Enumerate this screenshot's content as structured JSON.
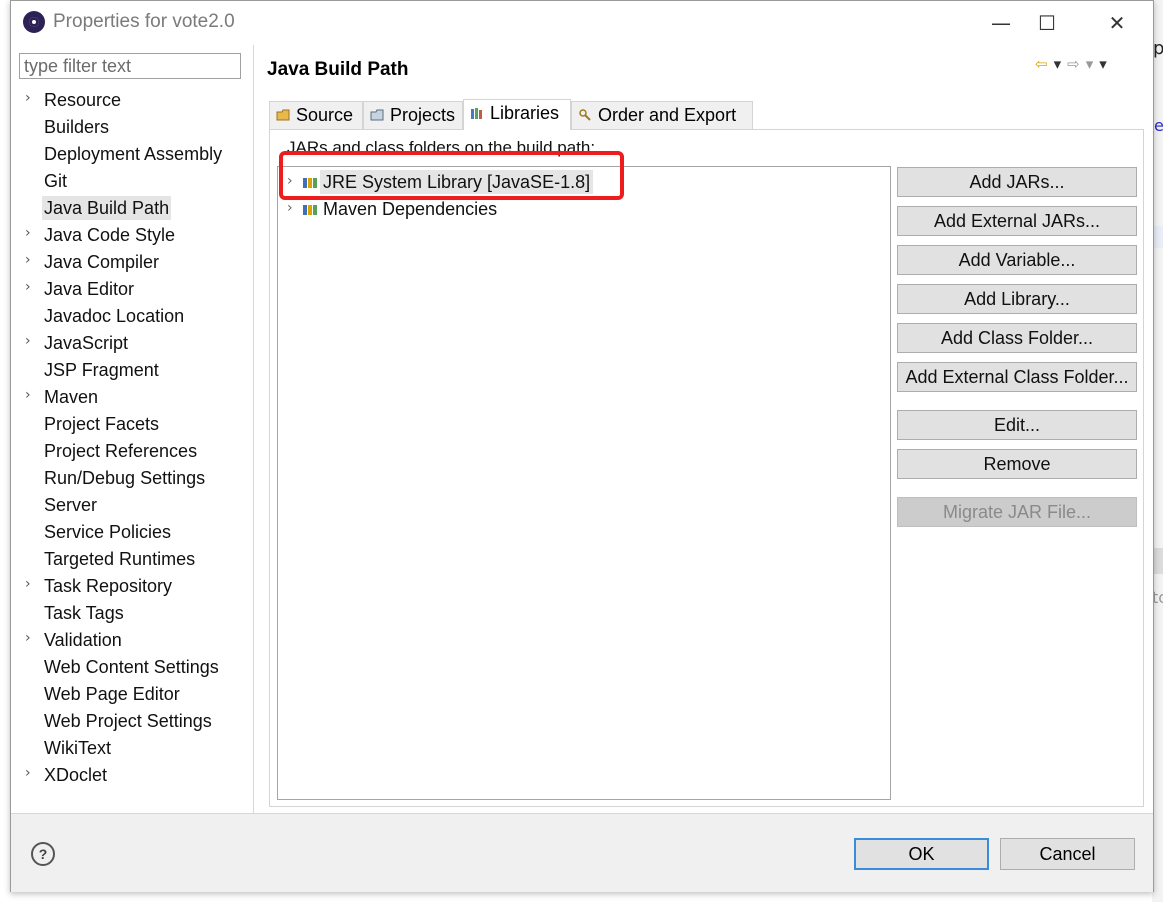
{
  "window": {
    "title": "Properties for vote2.0",
    "minimize": "—",
    "maximize": "☐",
    "close": "✕"
  },
  "filter": {
    "placeholder": "type filter text",
    "value": ""
  },
  "tree": {
    "items": [
      {
        "label": "Resource",
        "expandable": true
      },
      {
        "label": "Builders",
        "expandable": false
      },
      {
        "label": "Deployment Assembly",
        "expandable": false
      },
      {
        "label": "Git",
        "expandable": false
      },
      {
        "label": "Java Build Path",
        "expandable": false,
        "selected": true
      },
      {
        "label": "Java Code Style",
        "expandable": true
      },
      {
        "label": "Java Compiler",
        "expandable": true
      },
      {
        "label": "Java Editor",
        "expandable": true
      },
      {
        "label": "Javadoc Location",
        "expandable": false
      },
      {
        "label": "JavaScript",
        "expandable": true
      },
      {
        "label": "JSP Fragment",
        "expandable": false
      },
      {
        "label": "Maven",
        "expandable": true
      },
      {
        "label": "Project Facets",
        "expandable": false
      },
      {
        "label": "Project References",
        "expandable": false
      },
      {
        "label": "Run/Debug Settings",
        "expandable": false
      },
      {
        "label": "Server",
        "expandable": false
      },
      {
        "label": "Service Policies",
        "expandable": false
      },
      {
        "label": "Targeted Runtimes",
        "expandable": false
      },
      {
        "label": "Task Repository",
        "expandable": true
      },
      {
        "label": "Task Tags",
        "expandable": false
      },
      {
        "label": "Validation",
        "expandable": true
      },
      {
        "label": "Web Content Settings",
        "expandable": false
      },
      {
        "label": "Web Page Editor",
        "expandable": false
      },
      {
        "label": "Web Project Settings",
        "expandable": false
      },
      {
        "label": "WikiText",
        "expandable": false
      },
      {
        "label": "XDoclet",
        "expandable": true
      }
    ]
  },
  "page": {
    "title": "Java Build Path"
  },
  "tabs": [
    {
      "label": "Source",
      "icon": "source-folder-icon"
    },
    {
      "label": "Projects",
      "icon": "projects-icon"
    },
    {
      "label": "Libraries",
      "icon": "libraries-icon",
      "active": true
    },
    {
      "label": "Order and Export",
      "icon": "order-export-icon"
    }
  ],
  "libraries": {
    "label": "JARs and class folders on the build path:",
    "entries": [
      {
        "label": "JRE System Library [JavaSE-1.8]",
        "selected": true
      },
      {
        "label": "Maven Dependencies",
        "selected": false
      }
    ]
  },
  "buttons": {
    "add_jars": "Add JARs...",
    "add_external_jars": "Add External JARs...",
    "add_variable": "Add Variable...",
    "add_library": "Add Library...",
    "add_class_folder": "Add Class Folder...",
    "add_external_class_folder": "Add External Class Folder...",
    "edit": "Edit...",
    "remove": "Remove",
    "migrate_jar": "Migrate JAR File..."
  },
  "footer": {
    "help": "?",
    "ok": "OK",
    "cancel": "Cancel"
  },
  "colors": {
    "highlight": "#ee1c1c",
    "ok_focus": "#3c8bd9",
    "selection": "#e5e5e5"
  }
}
